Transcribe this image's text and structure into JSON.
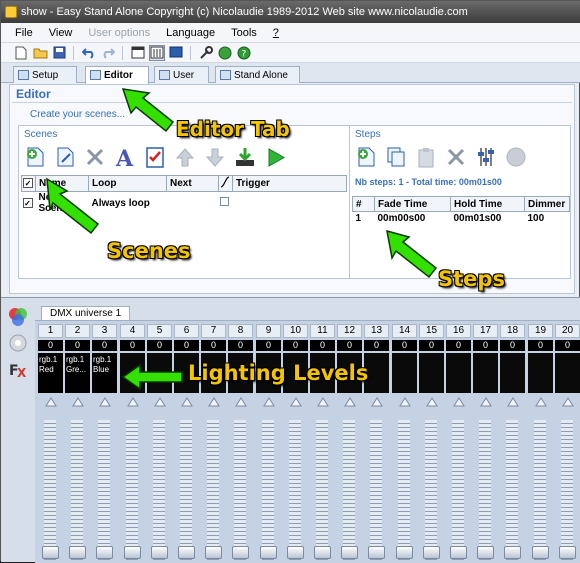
{
  "window": {
    "title": "show - Easy Stand Alone    Copyright (c) Nicolaudie 1989-2012    Web site www.nicolaudie.com"
  },
  "menu": [
    "File",
    "View",
    "User options",
    "Language",
    "Tools",
    "?"
  ],
  "tabs": [
    "Setup",
    "Editor",
    "User",
    "Stand Alone"
  ],
  "editor": {
    "title": "Editor",
    "create_link": "Create your scenes..."
  },
  "scenes": {
    "title": "Scenes",
    "columns": [
      "Name",
      "Loop",
      "Next",
      "Trigger"
    ],
    "rows": [
      {
        "name": "New Scene",
        "loop": "Always loop",
        "next": "",
        "checked": true
      }
    ]
  },
  "steps": {
    "title": "Steps",
    "summary": "Nb steps: 1 - Total time: 00m01s00",
    "columns": [
      "#",
      "Fade Time",
      "Hold Time",
      "Dimmer"
    ],
    "rows": [
      {
        "num": "1",
        "fade": "00m00s00",
        "hold": "00m01s00",
        "dimmer": "100"
      }
    ]
  },
  "dmx": {
    "tab": "DMX universe 1",
    "channels": [
      {
        "num": "1",
        "value": "0",
        "label": "rgb.1 Red"
      },
      {
        "num": "2",
        "value": "0",
        "label": "rgb.1 Gre..."
      },
      {
        "num": "3",
        "value": "0",
        "label": "rgb.1 Blue"
      },
      {
        "num": "4",
        "value": "0",
        "label": ""
      },
      {
        "num": "5",
        "value": "0",
        "label": ""
      },
      {
        "num": "6",
        "value": "0",
        "label": ""
      },
      {
        "num": "7",
        "value": "0",
        "label": ""
      },
      {
        "num": "8",
        "value": "0",
        "label": ""
      },
      {
        "num": "9",
        "value": "0",
        "label": ""
      },
      {
        "num": "10",
        "value": "0",
        "label": ""
      },
      {
        "num": "11",
        "value": "0",
        "label": ""
      },
      {
        "num": "12",
        "value": "0",
        "label": ""
      },
      {
        "num": "13",
        "value": "0",
        "label": ""
      },
      {
        "num": "14",
        "value": "0",
        "label": ""
      },
      {
        "num": "15",
        "value": "0",
        "label": ""
      },
      {
        "num": "16",
        "value": "0",
        "label": ""
      },
      {
        "num": "17",
        "value": "0",
        "label": ""
      },
      {
        "num": "18",
        "value": "0",
        "label": ""
      },
      {
        "num": "19",
        "value": "0",
        "label": ""
      },
      {
        "num": "20",
        "value": "0",
        "label": ""
      }
    ]
  },
  "callouts": {
    "editor_tab": "Editor Tab",
    "scenes": "Scenes",
    "steps": "Steps",
    "lighting": "Lighting Levels"
  },
  "colors": {
    "accent": "#3a6fb5",
    "callout_text": "#f5c400",
    "arrow": "#33e000"
  }
}
